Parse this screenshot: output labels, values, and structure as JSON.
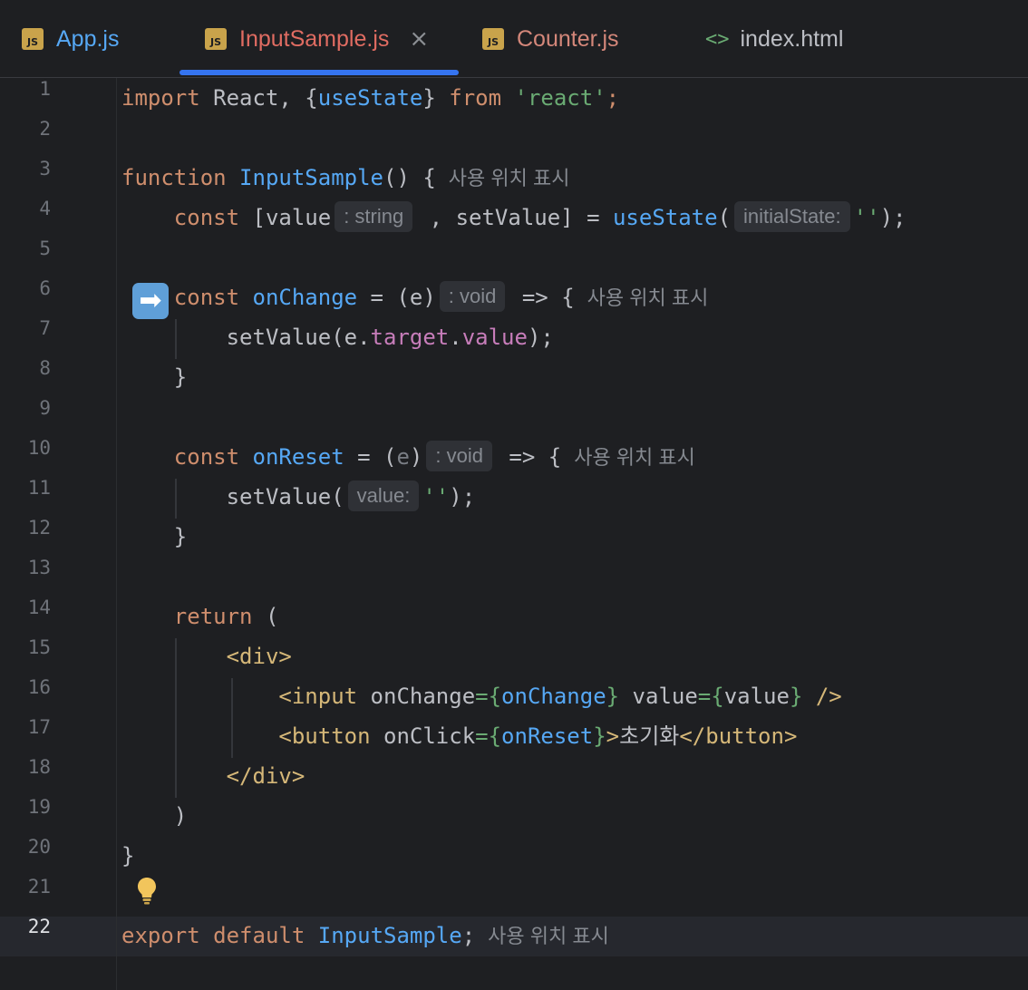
{
  "tabs": [
    {
      "label": "App.js",
      "icon": "JS",
      "color": "#56a8f5"
    },
    {
      "label": "InputSample.js",
      "icon": "JS",
      "color": "#e06c62",
      "active": true,
      "close": "×"
    },
    {
      "label": "Counter.js",
      "icon": "JS",
      "color": "#d4877a"
    },
    {
      "label": "index.html",
      "icon": "<>",
      "color": "#bcbec4"
    }
  ],
  "gutter": [
    "1",
    "2",
    "3",
    "4",
    "5",
    "6",
    "7",
    "8",
    "9",
    "10",
    "11",
    "12",
    "13",
    "14",
    "15",
    "16",
    "17",
    "18",
    "19",
    "20",
    "21",
    "22"
  ],
  "hints": {
    "usage": "사용 위치 표시",
    "string_type": ": string",
    "void_type": ": void",
    "initial_state": "initialState:",
    "value_param": "value:"
  },
  "code": {
    "l1": {
      "import": "import",
      "react": " React, {",
      "useState": "useState",
      "close": "} ",
      "from": "from",
      "sp": " ",
      "mod": "'react'",
      "semi": ";"
    },
    "l3": {
      "function": "function",
      "sp": " ",
      "name": "InputSample",
      "rest": "() {"
    },
    "l4": {
      "indent": "    ",
      "const": "const",
      "mid": " [value",
      "mid2": " , setValue] = ",
      "useState": "useState",
      "open": "(",
      "str": "''",
      "end": ");"
    },
    "l6": {
      "indent": "    ",
      "const": "const",
      "sp": " ",
      "name": "onChange",
      "rest": " = (e)",
      "arrow": " => {"
    },
    "l7": {
      "indent": "        ",
      "call": "setValue(e.",
      "target": "target",
      "dot": ".",
      "value": "value",
      "end": ");"
    },
    "l8": {
      "indent": "    ",
      "brace": "}"
    },
    "l10": {
      "indent": "    ",
      "const": "const",
      "sp": " ",
      "name": "onReset",
      "eq": " = (",
      "e": "e",
      ")": ")",
      "arrow": " => {"
    },
    "l11": {
      "indent": "        ",
      "call": "setValue(",
      "str": "''",
      "end": ");"
    },
    "l12": {
      "indent": "    ",
      "brace": "}"
    },
    "l14": {
      "indent": "    ",
      "return": "return",
      "rest": " ("
    },
    "l15": {
      "indent": "        ",
      "tag": "<div>"
    },
    "l16": {
      "indent": "            ",
      "open": "<input",
      "a1": " onChange",
      "eq1": "={",
      "v1": "onChange",
      "c1": "}",
      "a2": " value",
      "eq2": "={",
      "v2": "value",
      "c2": "}",
      "close": " />"
    },
    "l17": {
      "indent": "            ",
      "open": "<button",
      "a1": " onClick",
      "eq1": "={",
      "v1": "onReset",
      "c1": "}",
      "gt": ">",
      "text": "초기화",
      "close": "</button>"
    },
    "l18": {
      "indent": "        ",
      "tag": "</div>"
    },
    "l19": {
      "indent": "    ",
      "paren": ")"
    },
    "l20": {
      "brace": "}"
    },
    "l22": {
      "export": "export",
      "sp": " ",
      "default": "default",
      "sp2": " ",
      "name": "InputSample",
      "semi": ";"
    }
  }
}
